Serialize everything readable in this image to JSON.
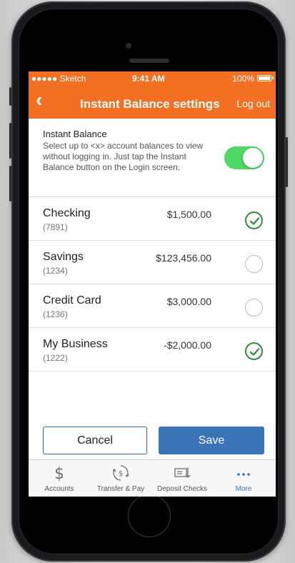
{
  "status": {
    "carrier": "●●●●● Sketch",
    "time": "9:41 AM",
    "battery": "100%"
  },
  "nav": {
    "title": "Instant Balance settings",
    "logout_label": "Log out"
  },
  "instant_balance": {
    "title": "Instant Balance",
    "description": "Select up to <x> account balances to view without logging in. Just tap the Instant Balance button on the Login screen.",
    "enabled": true
  },
  "accounts": [
    {
      "name": "Checking",
      "number": "(7891)",
      "balance": "$1,500.00",
      "selected": true
    },
    {
      "name": "Savings",
      "number": "(1234)",
      "balance": "$123,456.00",
      "selected": false
    },
    {
      "name": "Credit Card",
      "number": "(1236)",
      "balance": "$3,000.00",
      "selected": false
    },
    {
      "name": "My Business",
      "number": "(1222)",
      "balance": "-$2,000.00",
      "selected": true
    }
  ],
  "actions": {
    "cancel_label": "Cancel",
    "save_label": "Save"
  },
  "tabs": [
    {
      "label": "Accounts",
      "icon": "dollar-icon"
    },
    {
      "label": "Transfer & Pay",
      "icon": "transfer-icon"
    },
    {
      "label": "Deposit Checks",
      "icon": "deposit-check-icon"
    },
    {
      "label": "More",
      "icon": "more-icon",
      "active": true
    }
  ],
  "colors": {
    "brand": "#f36f21",
    "primary": "#3b73b9",
    "toggle_on": "#4cd964",
    "check": "#2e8b3f"
  }
}
